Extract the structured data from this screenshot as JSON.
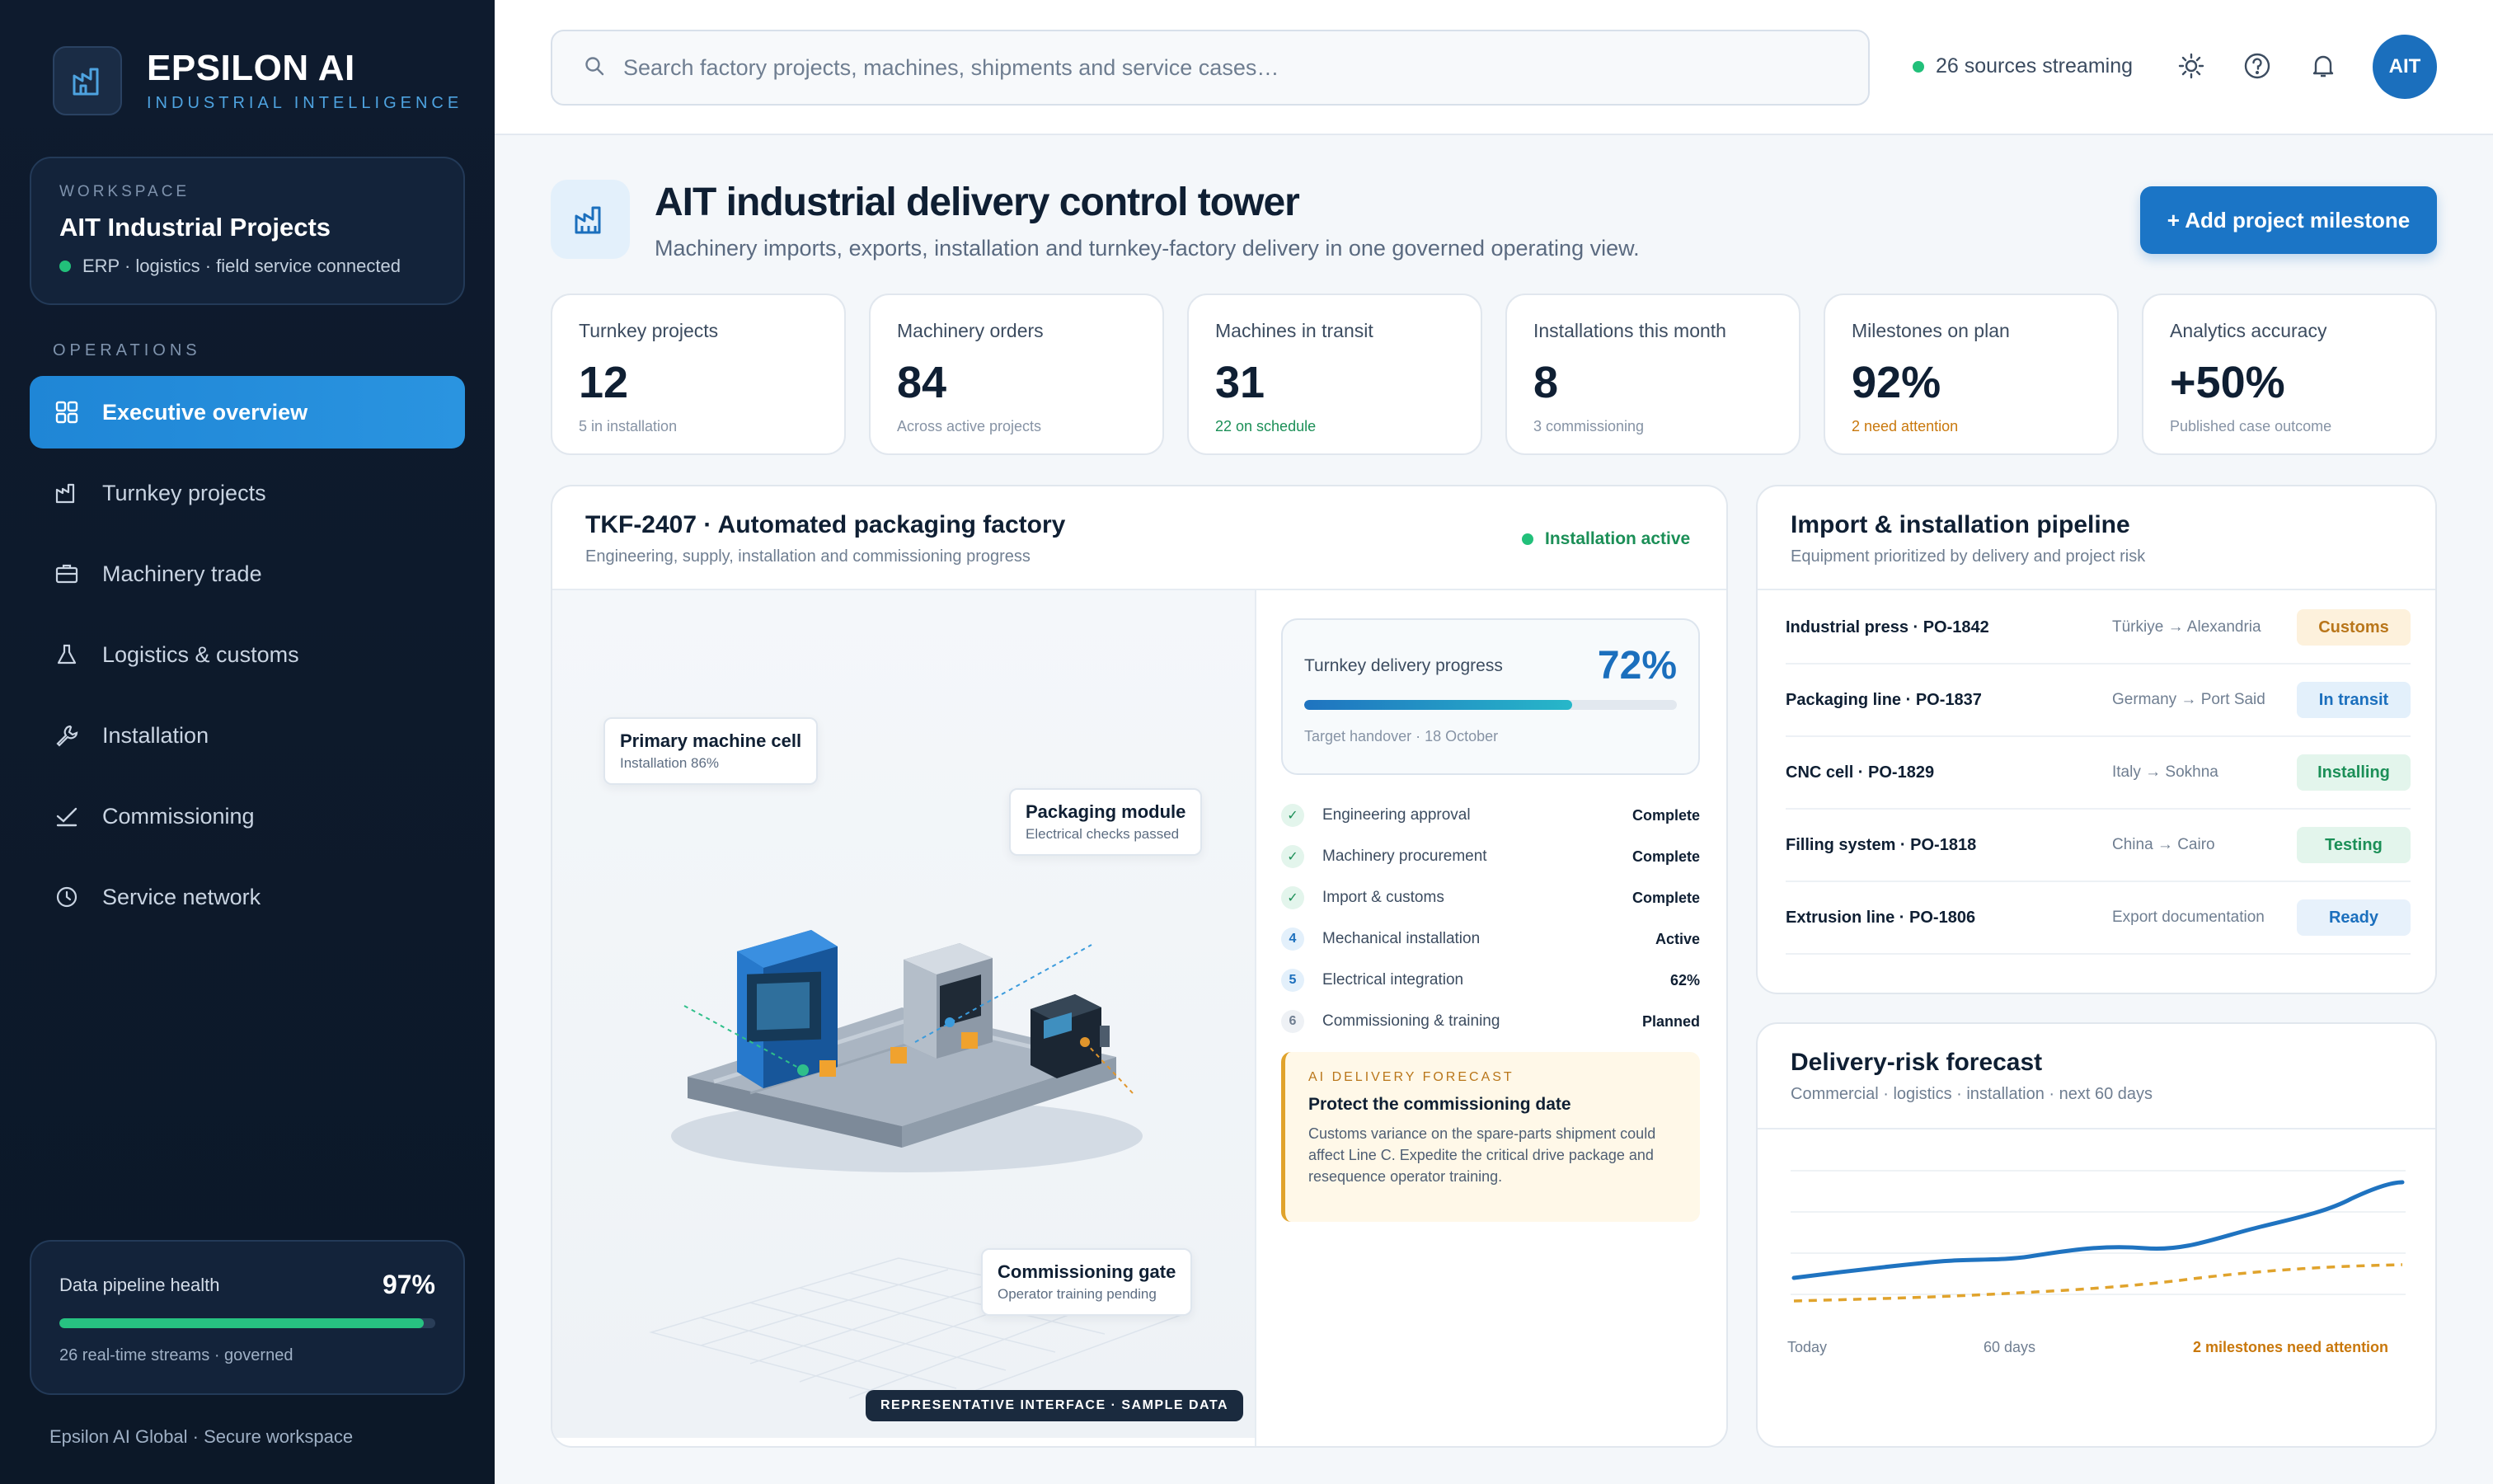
{
  "brand": {
    "name": "EPSILON AI",
    "tagline": "INDUSTRIAL INTELLIGENCE"
  },
  "workspace": {
    "label": "WORKSPACE",
    "name": "AIT Industrial Projects",
    "status": "ERP · logistics · field service connected"
  },
  "nav": {
    "section_label": "OPERATIONS",
    "items": [
      {
        "label": "Executive overview",
        "icon": "grid-icon",
        "active": true
      },
      {
        "label": "Turnkey projects",
        "icon": "factory-icon"
      },
      {
        "label": "Machinery trade",
        "icon": "briefcase-icon"
      },
      {
        "label": "Logistics & customs",
        "icon": "flask-icon"
      },
      {
        "label": "Installation",
        "icon": "wrench-icon"
      },
      {
        "label": "Commissioning",
        "icon": "check-icon"
      },
      {
        "label": "Service network",
        "icon": "clock-icon"
      }
    ]
  },
  "health": {
    "label": "Data pipeline health",
    "value": "97%",
    "percent": 97,
    "note": "26 real-time streams · governed"
  },
  "footer": "Epsilon AI Global · Secure workspace",
  "topbar": {
    "search_placeholder": "Search factory projects, machines, shipments and service cases…",
    "stream_status": "26 sources streaming",
    "avatar": "AIT"
  },
  "header": {
    "title": "AIT industrial delivery control tower",
    "subtitle": "Machinery imports, exports, installation and turnkey-factory delivery in one governed operating view.",
    "add_button": "+ Add project milestone"
  },
  "kpis": [
    {
      "label": "Turnkey projects",
      "value": "12",
      "note": "5 in installation",
      "tone": ""
    },
    {
      "label": "Machinery orders",
      "value": "84",
      "note": "Across active projects",
      "tone": ""
    },
    {
      "label": "Machines in transit",
      "value": "31",
      "note": "22 on schedule",
      "tone": "green"
    },
    {
      "label": "Installations this month",
      "value": "8",
      "note": "3 commissioning",
      "tone": ""
    },
    {
      "label": "Milestones on plan",
      "value": "92%",
      "note": "2 need attention",
      "tone": "amber"
    },
    {
      "label": "Analytics accuracy",
      "value": "+50%",
      "note": "Published case outcome",
      "tone": ""
    }
  ],
  "project": {
    "title": "TKF-2407 · Automated packaging factory",
    "subtitle": "Engineering, supply, installation and commissioning progress",
    "status": "Installation active",
    "callouts": [
      {
        "title": "Primary machine cell",
        "sub": "Installation 86%"
      },
      {
        "title": "Packaging module",
        "sub": "Electrical checks passed"
      },
      {
        "title": "Commissioning gate",
        "sub": "Operator training pending"
      }
    ],
    "sample_tag": "REPRESENTATIVE INTERFACE · SAMPLE DATA",
    "progress": {
      "label": "Turnkey delivery progress",
      "value": "72%",
      "percent": 72,
      "note": "Target handover · 18 October"
    },
    "steps": [
      {
        "mark": "✓",
        "kind": "done",
        "name": "Engineering approval",
        "state": "Complete"
      },
      {
        "mark": "✓",
        "kind": "done",
        "name": "Machinery procurement",
        "state": "Complete"
      },
      {
        "mark": "✓",
        "kind": "done",
        "name": "Import & customs",
        "state": "Complete"
      },
      {
        "mark": "4",
        "kind": "active",
        "name": "Mechanical installation",
        "state": "Active"
      },
      {
        "mark": "5",
        "kind": "active",
        "name": "Electrical integration",
        "state": "62%"
      },
      {
        "mark": "6",
        "kind": "planned",
        "name": "Commissioning & training",
        "state": "Planned"
      }
    ],
    "forecast": {
      "label": "AI DELIVERY FORECAST",
      "title": "Protect the commissioning date",
      "body": "Customs variance on the spare-parts shipment could affect Line C. Expedite the critical drive package and resequence operator training."
    }
  },
  "pipeline": {
    "title": "Import & installation pipeline",
    "subtitle": "Equipment prioritized by delivery and project risk",
    "rows": [
      {
        "name": "Industrial press · PO-1842",
        "route": "Türkiye → Alexandria",
        "badge": "Customs",
        "bg": "#fdf1dc",
        "fg": "#b9761a"
      },
      {
        "name": "Packaging line · PO-1837",
        "route": "Germany → Port Said",
        "badge": "In transit",
        "bg": "#e3f0fb",
        "fg": "#1b6fbd"
      },
      {
        "name": "CNC cell · PO-1829",
        "route": "Italy → Sokhna",
        "badge": "Installing",
        "bg": "#e3f5ec",
        "fg": "#1b8f57"
      },
      {
        "name": "Filling system · PO-1818",
        "route": "China → Cairo",
        "badge": "Testing",
        "bg": "#e3f5ec",
        "fg": "#1b8f57"
      },
      {
        "name": "Extrusion line · PO-1806",
        "route": "Export documentation",
        "badge": "Ready",
        "bg": "#e7f1fb",
        "fg": "#1b6fbd"
      }
    ]
  },
  "risk": {
    "title": "Delivery-risk forecast",
    "subtitle": "Commercial · logistics · installation · next 60 days",
    "x_start": "Today",
    "x_mid": "60 days",
    "attention": "2 milestones need attention",
    "colors": {
      "line": "#1f73c0",
      "dashed": "#e0a32c"
    }
  }
}
